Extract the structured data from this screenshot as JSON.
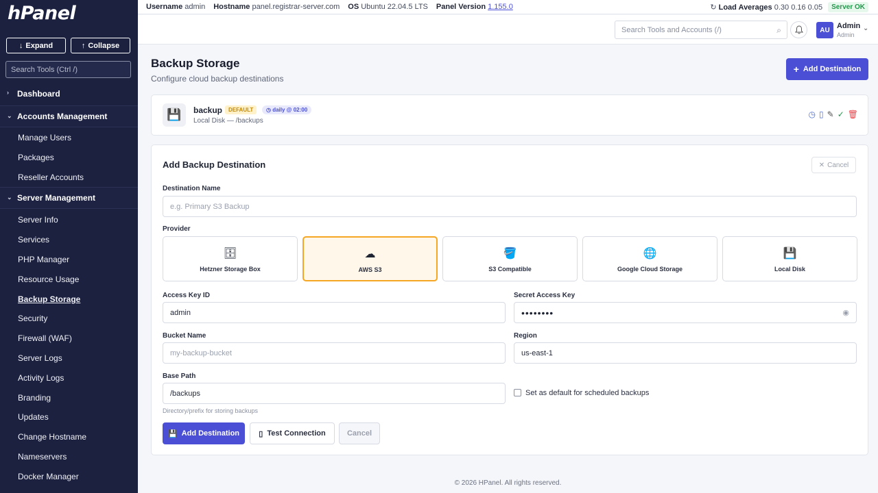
{
  "sidebar": {
    "logo": "hPanel",
    "expand": "Expand",
    "collapse": "Collapse",
    "search_placeholder": "Search Tools (Ctrl /)",
    "dashboard": "Dashboard",
    "accounts_section": "Accounts Management",
    "accounts_items": [
      "Manage Users",
      "Packages",
      "Reseller Accounts"
    ],
    "server_section": "Server Management",
    "server_items": [
      "Server Info",
      "Services",
      "PHP Manager",
      "Resource Usage",
      "Backup Storage",
      "Security",
      "Firewall (WAF)",
      "Server Logs",
      "Activity Logs",
      "Branding",
      "Updates",
      "Change Hostname",
      "Nameservers",
      "Docker Manager"
    ],
    "active_item": "Backup Storage"
  },
  "topbar": {
    "username_label": "Username",
    "username": "admin",
    "hostname_label": "Hostname",
    "hostname": "panel.registrar-server.com",
    "os_label": "OS",
    "os": "Ubuntu 22.04.5 LTS",
    "panel_version_label": "Panel Version",
    "panel_version": "1.155.0",
    "load_label": "Load Averages",
    "load": "0.30 0.16 0.05",
    "status": "Server OK"
  },
  "header": {
    "search_placeholder": "Search Tools and Accounts (/)",
    "avatar": "AU",
    "user_name": "Admin",
    "user_role": "Admin"
  },
  "page": {
    "title": "Backup Storage",
    "subtitle": "Configure cloud backup destinations",
    "add_button": "Add Destination"
  },
  "destination": {
    "name": "backup",
    "badge": "DEFAULT",
    "schedule": "daily @ 02:00",
    "detail": "Local Disk — /backups"
  },
  "form": {
    "title": "Add Backup Destination",
    "cancel_top": "Cancel",
    "dest_name_label": "Destination Name",
    "dest_name_placeholder": "e.g. Primary S3 Backup",
    "provider_label": "Provider",
    "providers": [
      "Hetzner Storage Box",
      "AWS S3",
      "S3 Compatible",
      "Google Cloud Storage",
      "Local Disk"
    ],
    "selected_provider": "AWS S3",
    "access_key_label": "Access Key ID",
    "access_key_value": "admin",
    "secret_key_label": "Secret Access Key",
    "secret_key_value": "••••••••",
    "bucket_label": "Bucket Name",
    "bucket_placeholder": "my-backup-bucket",
    "region_label": "Region",
    "region_value": "us-east-1",
    "base_path_label": "Base Path",
    "base_path_value": "/backups",
    "base_path_hint": "Directory/prefix for storing backups",
    "default_checkbox_label": "Set as default for scheduled backups",
    "submit": "Add Destination",
    "test": "Test Connection",
    "cancel": "Cancel"
  },
  "footer": "© 2026 HPanel. All rights reserved.",
  "colors": {
    "sidebar_bg": "#1c2140",
    "primary": "#4b4fd6",
    "selected_provider_border": "#f5a623"
  }
}
